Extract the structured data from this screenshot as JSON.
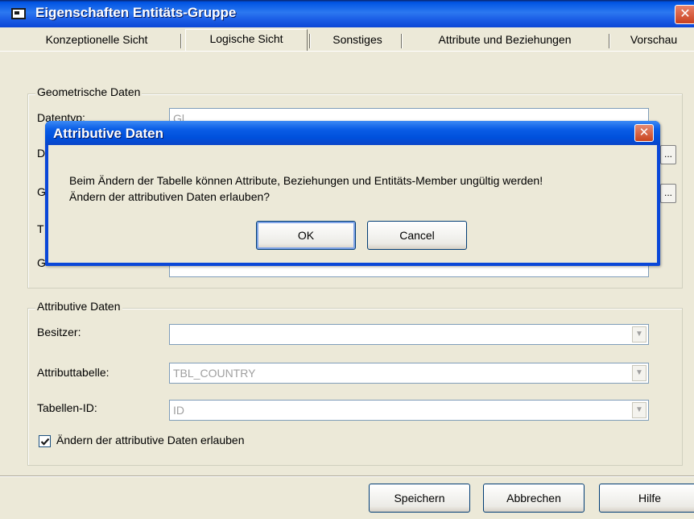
{
  "window": {
    "title": "Eigenschaften Entitäts-Gruppe",
    "close_glyph": "✕"
  },
  "tabs": [
    {
      "label": "Konzeptionelle Sicht"
    },
    {
      "label": "Logische Sicht"
    },
    {
      "label": "Sonstiges"
    },
    {
      "label": "Attribute und Beziehungen"
    },
    {
      "label": "Vorschau"
    }
  ],
  "geometric": {
    "legend": "Geometrische Daten",
    "fields": [
      {
        "label": "Datentyp:",
        "value": "Gl"
      },
      {
        "label": "D"
      },
      {
        "label": "G"
      },
      {
        "label": "T"
      },
      {
        "label": "G"
      }
    ],
    "browse_glyph": "..."
  },
  "attributive": {
    "legend": "Attributive Daten",
    "owner": {
      "label": "Besitzer:",
      "value": ""
    },
    "table": {
      "label": "Attributtabelle:",
      "value": "TBL_COUNTRY"
    },
    "table_id": {
      "label": "Tabellen-ID:",
      "value": "ID"
    },
    "allow_change": {
      "label": "Ändern der attributive Daten erlauben",
      "checked": true
    }
  },
  "footer": {
    "save": "Speichern",
    "cancel": "Abbrechen",
    "help": "Hilfe"
  },
  "dialog": {
    "title": "Attributive Daten",
    "message_line1": "Beim Ändern der Tabelle können Attribute, Beziehungen und Entitäts-Member ungültig werden!",
    "message_line2": "Ändern der attributiven Daten erlauben?",
    "ok": "OK",
    "cancel": "Cancel",
    "close_glyph": "✕"
  },
  "colors": {
    "titlebar": "#0054e3",
    "window_bg": "#ece9d8",
    "close_red": "#c8401f"
  }
}
